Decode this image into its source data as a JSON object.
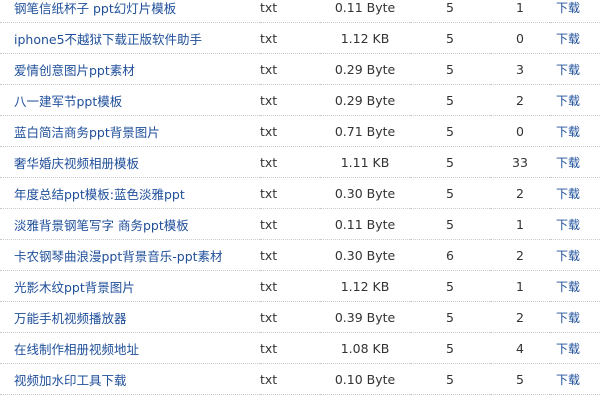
{
  "download_label": "下载",
  "rows": [
    {
      "name": "钢笔信纸杯子 ppt幻灯片模板",
      "type": "txt",
      "size": "0.11 Byte",
      "col4": "5",
      "col5": "1"
    },
    {
      "name": "iphone5不越狱下载正版软件助手",
      "type": "txt",
      "size": "1.12 KB",
      "col4": "5",
      "col5": "0"
    },
    {
      "name": "爱情创意图片ppt素材",
      "type": "txt",
      "size": "0.29 Byte",
      "col4": "5",
      "col5": "3"
    },
    {
      "name": "八一建军节ppt模板",
      "type": "txt",
      "size": "0.29 Byte",
      "col4": "5",
      "col5": "2"
    },
    {
      "name": "蓝白简洁商务ppt背景图片",
      "type": "txt",
      "size": "0.71 Byte",
      "col4": "5",
      "col5": "0"
    },
    {
      "name": "奢华婚庆视频相册模板",
      "type": "txt",
      "size": "1.11 KB",
      "col4": "5",
      "col5": "33"
    },
    {
      "name": "年度总结ppt模板:蓝色淡雅ppt",
      "type": "txt",
      "size": "0.30 Byte",
      "col4": "5",
      "col5": "2"
    },
    {
      "name": "淡雅背景钢笔写字 商务ppt模板",
      "type": "txt",
      "size": "0.11 Byte",
      "col4": "5",
      "col5": "1"
    },
    {
      "name": "卡农钢琴曲浪漫ppt背景音乐-ppt素材",
      "type": "txt",
      "size": "0.30 Byte",
      "col4": "6",
      "col5": "2"
    },
    {
      "name": "光影木纹ppt背景图片",
      "type": "txt",
      "size": "1.12 KB",
      "col4": "5",
      "col5": "1"
    },
    {
      "name": "万能手机视频播放器",
      "type": "txt",
      "size": "0.39 Byte",
      "col4": "5",
      "col5": "2"
    },
    {
      "name": "在线制作相册视频地址",
      "type": "txt",
      "size": "1.08 KB",
      "col4": "5",
      "col5": "4"
    },
    {
      "name": "视频加水印工具下载",
      "type": "txt",
      "size": "0.10 Byte",
      "col4": "5",
      "col5": "5"
    }
  ]
}
